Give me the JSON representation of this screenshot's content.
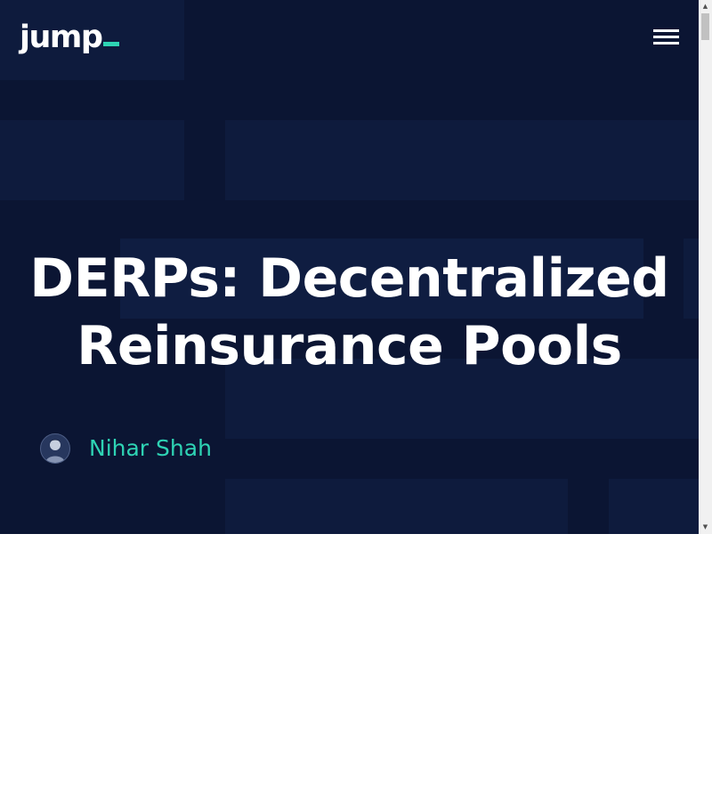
{
  "header": {
    "logo_text": "jump",
    "logo_accent_color": "#2ed3b4",
    "menu_icon": "hamburger-menu-icon"
  },
  "article": {
    "title": "DERPs: Decentralized Reinsurance Pools",
    "author": {
      "name": "Nihar Shah",
      "avatar_icon": "author-avatar"
    }
  },
  "colors": {
    "background": "#0b1533",
    "accent": "#2ed3b4",
    "text": "#ffffff"
  },
  "scrollbar": {
    "up_icon": "scroll-up-arrow-icon",
    "down_icon": "scroll-down-arrow-icon"
  }
}
